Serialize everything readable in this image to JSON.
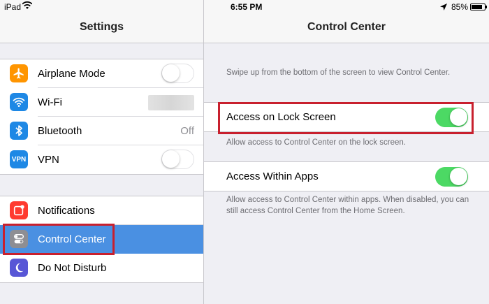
{
  "status_bar": {
    "device": "iPad",
    "time": "6:55 PM",
    "battery_pct": "85%",
    "battery_level": 0.85
  },
  "left": {
    "title": "Settings",
    "group1": [
      {
        "label": "Airplane Mode",
        "icon": "airplane-icon",
        "color": "#ff9500",
        "control": "toggle-off"
      },
      {
        "label": "Wi-Fi",
        "icon": "wifi-icon",
        "color": "#1e88e5",
        "control": "blurred-value"
      },
      {
        "label": "Bluetooth",
        "icon": "bluetooth-icon",
        "color": "#1e88e5",
        "control": "value",
        "value": "Off"
      },
      {
        "label": "VPN",
        "icon_text": "VPN",
        "icon": "vpn-icon",
        "color": "#1e88e5",
        "control": "toggle-off"
      }
    ],
    "group2": [
      {
        "label": "Notifications",
        "icon": "notifications-icon",
        "color": "#ff3b30"
      },
      {
        "label": "Control Center",
        "icon": "control-center-icon",
        "color": "#8e8e93",
        "selected": true
      },
      {
        "label": "Do Not Disturb",
        "icon": "moon-icon",
        "color": "#5856d6"
      }
    ]
  },
  "right": {
    "title": "Control Center",
    "intro": "Swipe up from the bottom of the screen to view Control Center.",
    "lock_screen": {
      "label": "Access on Lock Screen",
      "enabled": true,
      "footer": "Allow access to Control Center on the lock screen."
    },
    "within_apps": {
      "label": "Access Within Apps",
      "enabled": true,
      "footer": "Allow access to Control Center within apps. When disabled, you can still access Control Center from the Home Screen."
    }
  },
  "colors": {
    "selection": "#4a90e2",
    "toggle_on": "#4cd964",
    "highlight_box": "#c8202e"
  }
}
